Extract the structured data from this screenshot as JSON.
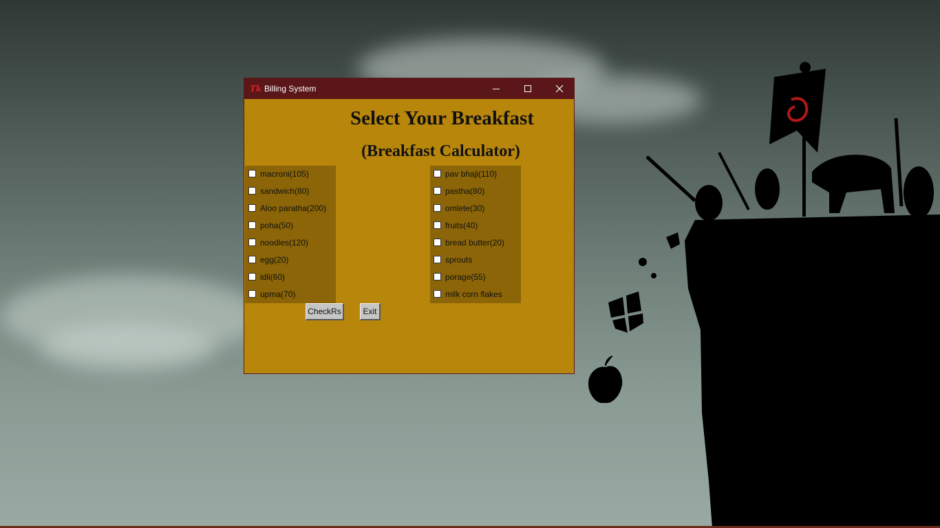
{
  "window": {
    "title": "Billing System",
    "icon": "tk-feather-icon"
  },
  "titlebar_buttons": [
    "minimize-icon",
    "maximize-icon",
    "close-icon"
  ],
  "main": {
    "heading": "Select Your Breakfast",
    "subheading": "(Breakfast Calculator)"
  },
  "left_items": [
    {
      "label": "macroni(105)",
      "checked": false
    },
    {
      "label": "sandwich(80)",
      "checked": false
    },
    {
      "label": "Aloo paratha(200)",
      "checked": false
    },
    {
      "label": "poha(50)",
      "checked": false
    },
    {
      "label": "noodles(120)",
      "checked": false
    },
    {
      "label": "egg(20)",
      "checked": false
    },
    {
      "label": "idli(60)",
      "checked": false
    },
    {
      "label": "upma(70)",
      "checked": false
    }
  ],
  "right_items": [
    {
      "label": "pav bhaji(110)",
      "checked": false
    },
    {
      "label": "pastha(80)",
      "checked": false
    },
    {
      "label": "omlete(30)",
      "checked": false
    },
    {
      "label": "fruits(40)",
      "checked": false
    },
    {
      "label": "bread butter(20)",
      "checked": false
    },
    {
      "label": "sprouts",
      "checked": false
    },
    {
      "label": "porage(55)",
      "checked": false
    },
    {
      "label": "milk corn flakes",
      "checked": false
    }
  ],
  "buttons": {
    "check_label": "CheckRs",
    "exit_label": "Exit"
  },
  "colors": {
    "window_bg": "#b8860b",
    "panel_bg": "#8b6508",
    "titlebar_bg": "#5a1618"
  }
}
